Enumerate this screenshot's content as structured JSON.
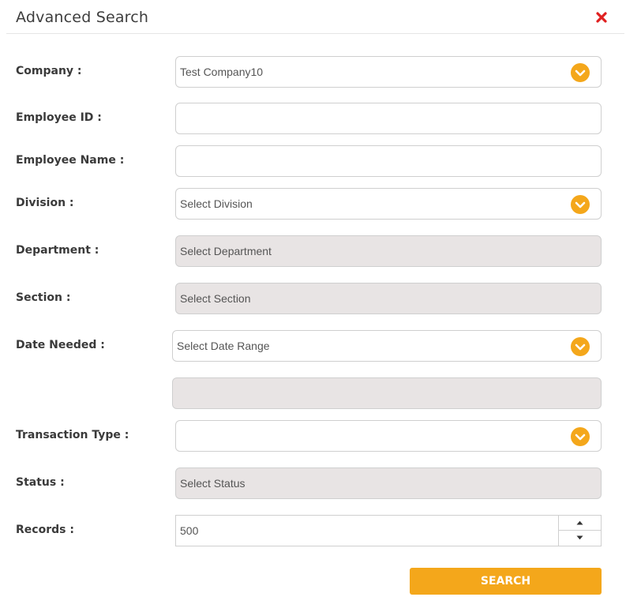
{
  "dialog": {
    "title": "Advanced Search"
  },
  "colors": {
    "accent": "#f4a71b",
    "close": "#e02020",
    "disabled_bg": "#e8e4e4"
  },
  "form": {
    "company_label": "Company :",
    "company_value": "Test Company10",
    "employee_id_label": "Employee ID :",
    "employee_id_value": "",
    "employee_name_label": "Employee Name :",
    "employee_name_value": "",
    "division_label": "Division :",
    "division_value": "Select Division",
    "department_label": "Department :",
    "department_value": "Select Department",
    "section_label": "Section :",
    "section_value": "Select Section",
    "date_needed_label": "Date Needed :",
    "date_needed_value": "Select Date Range",
    "date_range_value": "",
    "transaction_type_label": "Transaction Type :",
    "transaction_type_value": "",
    "status_label": "Status :",
    "status_value": "Select Status",
    "records_label": "Records :",
    "records_value": "500"
  },
  "actions": {
    "search_label": "SEARCH"
  },
  "icons": {
    "close": "close-icon",
    "dropdown": "chevron-down-icon",
    "spinner_up": "caret-up-icon",
    "spinner_down": "caret-down-icon"
  }
}
